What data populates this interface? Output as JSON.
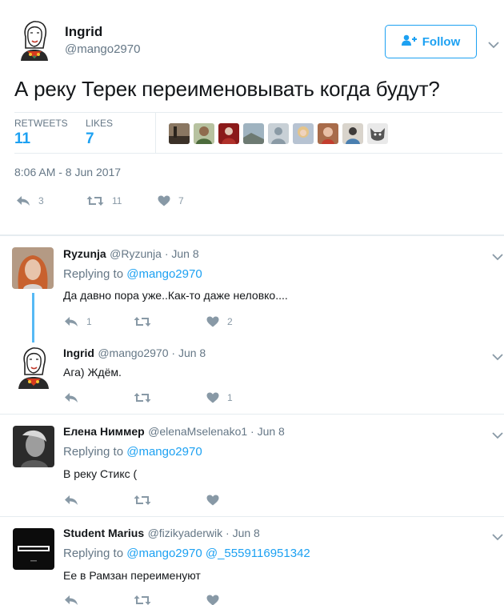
{
  "tweet": {
    "author_name": "Ingrid",
    "author_handle": "@mango2970",
    "follow_label": "Follow",
    "text": "А реку Терек переименовывать когда будут?",
    "retweets_label": "RETWEETS",
    "retweets_count": "11",
    "likes_label": "LIKES",
    "likes_count": "7",
    "timestamp": "8:06 AM - 8 Jun 2017",
    "actions": {
      "reply_count": "3",
      "retweet_count": "11",
      "like_count": "7"
    }
  },
  "colors": {
    "accent": "#1da1f2",
    "muted": "#657786",
    "icon": "#8899a6",
    "border": "#e6ecf0"
  },
  "replies": [
    {
      "name": "Ryzunja",
      "meta": "@Ryzunja · Jun 8",
      "replying_prefix": "Replying to",
      "mentions": "@mango2970",
      "text": "Да давно пора уже..Как-то даже неловко....",
      "reply_count": "1",
      "retweet_count": "",
      "like_count": "2"
    },
    {
      "name": "Ingrid",
      "meta": "@mango2970 · Jun 8",
      "text": "Ага) Ждём.",
      "reply_count": "",
      "retweet_count": "",
      "like_count": "1"
    },
    {
      "name": "Елена Ниммер",
      "meta": "@elenaMselenako1 · Jun 8",
      "replying_prefix": "Replying to",
      "mentions": "@mango2970",
      "text": "В реку Стикс (",
      "reply_count": "",
      "retweet_count": "",
      "like_count": ""
    },
    {
      "name": "Student Marius",
      "meta": "@fizikyaderwik · Jun 8",
      "replying_prefix": "Replying to",
      "mentions": "@mango2970 @_5559116951342",
      "text": "Ее в Рамзан переименуют",
      "reply_count": "",
      "retweet_count": "",
      "like_count": ""
    }
  ]
}
